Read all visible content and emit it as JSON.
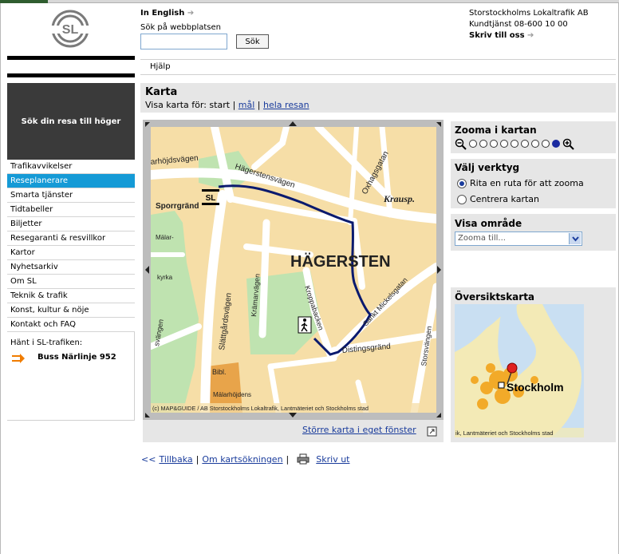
{
  "header": {
    "lang_link": "In English",
    "search_label": "Sök på webbplatsen",
    "search_value": "",
    "search_button": "Sök",
    "company": "Storstockholms Lokaltrafik AB",
    "customer_service": "Kundtjänst 08-600 10 00",
    "write_link": "Skriv till oss"
  },
  "logo": {
    "text": "SL"
  },
  "help_bar": {
    "label": "Hjälp"
  },
  "sidebar": {
    "travel_box": "Sök din resa till höger",
    "items": [
      {
        "label": "Trafikavvikelser",
        "active": false
      },
      {
        "label": "Reseplanerare",
        "active": true
      },
      {
        "label": "Smarta tjänster",
        "active": false
      },
      {
        "label": "Tidtabeller",
        "active": false
      },
      {
        "label": "Biljetter",
        "active": false
      },
      {
        "label": "Resegaranti & resvillkor",
        "active": false
      },
      {
        "label": "Kartor",
        "active": false
      },
      {
        "label": "Nyhetsarkiv",
        "active": false
      },
      {
        "label": "Om SL",
        "active": false
      },
      {
        "label": "Teknik & trafik",
        "active": false
      },
      {
        "label": "Konst, kultur & nöje",
        "active": false
      },
      {
        "label": "Kontakt och FAQ",
        "active": false
      }
    ],
    "traffic_label": "Hänt i SL-trafiken:",
    "traffic_link": "Buss Närlinje 952"
  },
  "karta": {
    "title": "Karta",
    "sub_prefix": "Visa karta för: start",
    "sep1": "|",
    "link_goal": "mål",
    "sep2": "|",
    "link_whole": "hela resan"
  },
  "map": {
    "labels": {
      "hagersten": "HÄGERSTEN",
      "hagerstensvagen": "Hägerstensvägen",
      "oxhagsgatan": "Oxhagsgatan",
      "krausp": "Krausp.",
      "arhojdsvagen": "arhöjdsvägen",
      "sporrgrand": "Sporrgränd",
      "malar": "Mälar-",
      "kyrka": "kyrka",
      "slattgardsvagen": "Slättgårdsvägen",
      "kramarvagen": "Krämarvägen",
      "kroppabacken": "Kroppabacken",
      "sankt_mickelsgatan": "Sankt Mickelsgatan",
      "storsvangen": "Storsvängen",
      "distingsgrand": "Distingsgränd",
      "svangen": "svängen",
      "bibl": "Bibl.",
      "malarhojdens": "Mälarhöjdens",
      "sl_marker": "SL",
      "copyright": "(c) MAP&GUIDE / AB Storstockholms Lokaltrafik, Lantmäteriet och Stockholms stad"
    }
  },
  "bigger_map": "Större karta i eget fönster",
  "zoom": {
    "title": "Zooma i kartan",
    "levels": 9,
    "selected": 9
  },
  "tools": {
    "title": "Välj verktyg",
    "options": [
      {
        "label": "Rita en ruta för att zooma",
        "checked": true
      },
      {
        "label": "Centrera kartan",
        "checked": false
      }
    ]
  },
  "area": {
    "title": "Visa område",
    "selected": "Zooma till..."
  },
  "overview": {
    "title": "Översiktskarta",
    "city_label": "Stockholm",
    "copyright": "ik, Lantmäteriet och Stockholms stad"
  },
  "bottom": {
    "back_prefix": "<<",
    "back": "Tillbaka",
    "sep1": "|",
    "about": "Om kartsökningen",
    "sep2": "|",
    "print": "Skriv ut"
  },
  "colors": {
    "accent_blue": "#159ad6",
    "link": "#1a3c9c",
    "route": "#0a1a6e",
    "panel_grey": "#e6e6e6"
  }
}
